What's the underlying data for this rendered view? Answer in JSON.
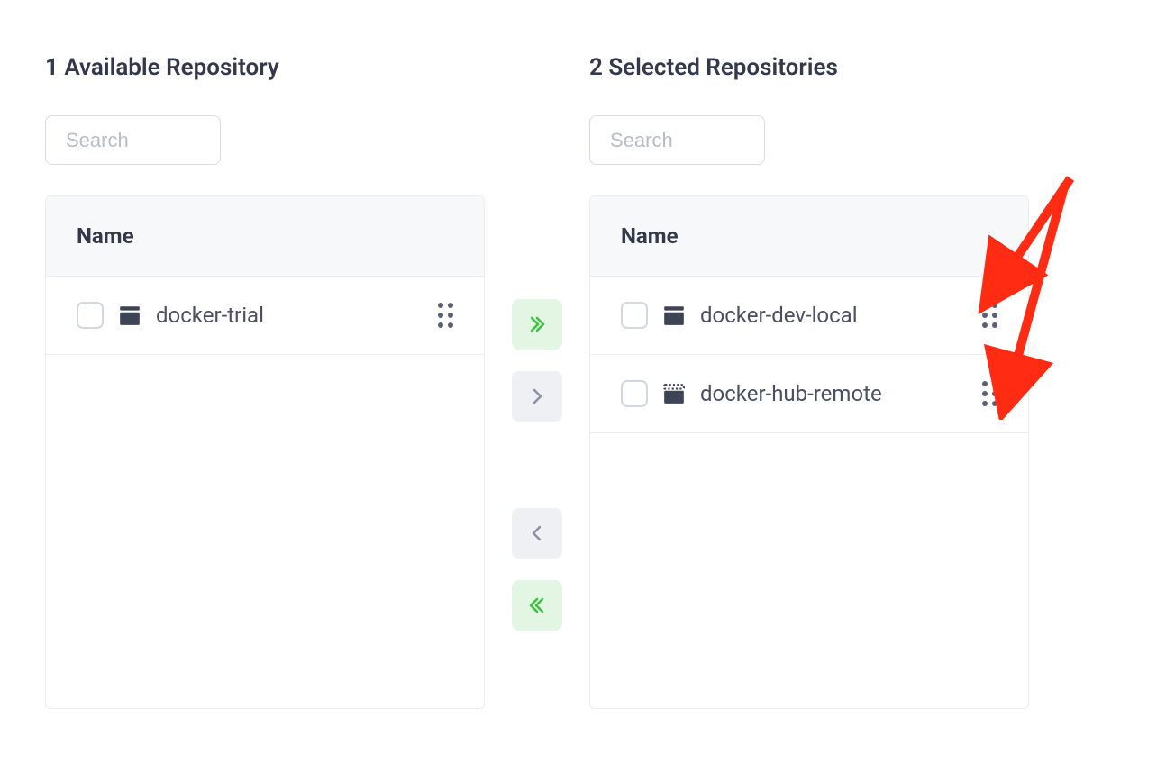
{
  "available": {
    "title": "1 Available Repository",
    "search_placeholder": "Search",
    "column_header": "Name",
    "items": [
      {
        "name": "docker-trial",
        "icon": "local"
      }
    ]
  },
  "selected": {
    "title": "2 Selected Repositories",
    "search_placeholder": "Search",
    "column_header": "Name",
    "items": [
      {
        "name": "docker-dev-local",
        "icon": "local"
      },
      {
        "name": "docker-hub-remote",
        "icon": "remote"
      }
    ]
  }
}
